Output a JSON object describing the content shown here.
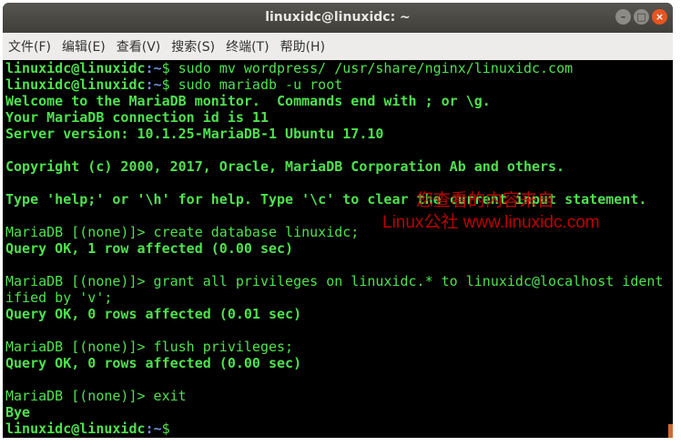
{
  "window": {
    "title": "linuxidc@linuxidc: ~"
  },
  "menu": [
    "文件(F)",
    "编辑(E)",
    "查看(V)",
    "搜索(S)",
    "终端(T)",
    "帮助(H)"
  ],
  "prompt": {
    "user": "linuxidc@linuxidc",
    "path": ":~",
    "sign": "$ "
  },
  "lines": [
    {
      "t": "prompt",
      "cmd": "sudo mv wordpress/ /usr/share/nginx/linuxidc.com"
    },
    {
      "t": "prompt",
      "cmd": "sudo mariadb -u root"
    },
    {
      "t": "b",
      "text": "Welcome to the MariaDB monitor.  Commands end with ; or \\g."
    },
    {
      "t": "b",
      "text": "Your MariaDB connection id is 11"
    },
    {
      "t": "b",
      "text": "Server version: 10.1.25-MariaDB-1 Ubuntu 17.10"
    },
    {
      "t": "n",
      "text": ""
    },
    {
      "t": "b",
      "text": "Copyright (c) 2000, 2017, Oracle, MariaDB Corporation Ab and others."
    },
    {
      "t": "n",
      "text": ""
    },
    {
      "t": "b",
      "text": "Type 'help;' or '\\h' for help. Type '\\c' to clear the current input statement."
    },
    {
      "t": "n",
      "text": ""
    },
    {
      "t": "n",
      "text": "MariaDB [(none)]> create database linuxidc;"
    },
    {
      "t": "b",
      "text": "Query OK, 1 row affected (0.00 sec)"
    },
    {
      "t": "n",
      "text": ""
    },
    {
      "t": "n",
      "text": "MariaDB [(none)]> grant all privileges on linuxidc.* to linuxidc@localhost ident"
    },
    {
      "t": "n",
      "text": "ified by 'v';"
    },
    {
      "t": "b",
      "text": "Query OK, 0 rows affected (0.01 sec)"
    },
    {
      "t": "n",
      "text": ""
    },
    {
      "t": "n",
      "text": "MariaDB [(none)]> flush privileges;"
    },
    {
      "t": "b",
      "text": "Query OK, 0 rows affected (0.00 sec)"
    },
    {
      "t": "n",
      "text": ""
    },
    {
      "t": "n",
      "text": "MariaDB [(none)]> exit"
    },
    {
      "t": "b",
      "text": "Bye"
    },
    {
      "t": "prompt",
      "cmd": ""
    }
  ],
  "watermark": {
    "line1": "您查看的内容来自",
    "line2": "Linux公社 www.linuxidc.com"
  }
}
